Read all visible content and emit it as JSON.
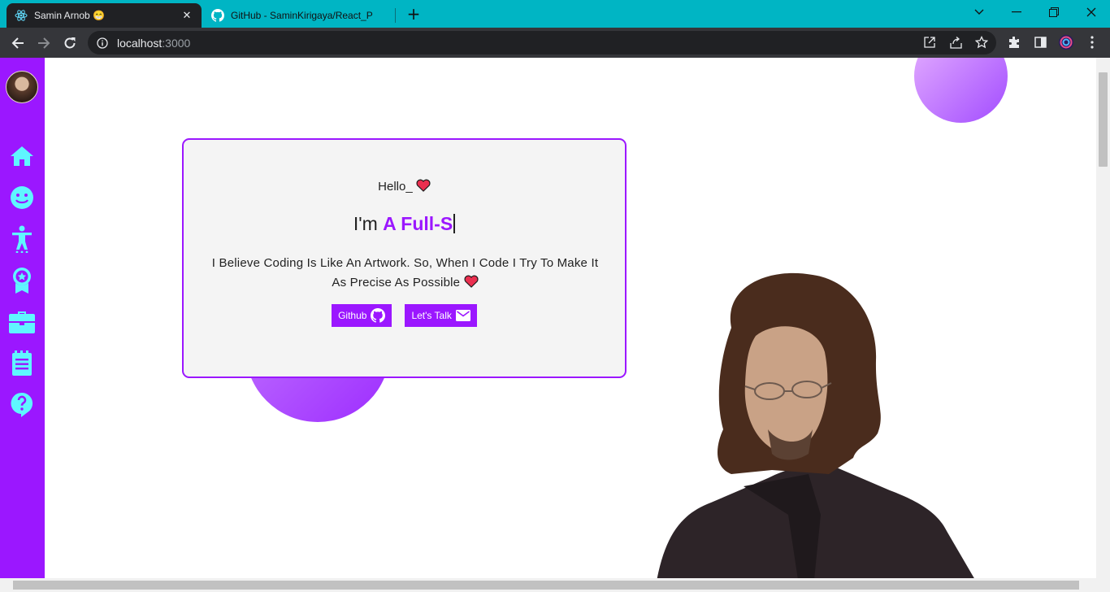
{
  "browser": {
    "tabs": [
      {
        "title": "Samin Arnob 😁",
        "active": true
      },
      {
        "title": "GitHub - SaminKirigaya/React_P",
        "active": false
      }
    ],
    "newtab_label": "+",
    "url_host": "localhost",
    "url_port": ":3000",
    "toolbar_icons": [
      "back-icon",
      "forward-icon",
      "reload-icon",
      "info-icon",
      "open-in-app-icon",
      "share-icon",
      "bookmark-star-icon",
      "extensions-icon",
      "side-panel-icon",
      "profile-icon",
      "menu-dots-icon"
    ]
  },
  "sidebar": {
    "items": [
      {
        "name": "home",
        "icon": "home-icon"
      },
      {
        "name": "about",
        "icon": "smiley-icon"
      },
      {
        "name": "skills",
        "icon": "accessibility-icon"
      },
      {
        "name": "achievements",
        "icon": "award-icon"
      },
      {
        "name": "experience",
        "icon": "briefcase-icon"
      },
      {
        "name": "blog",
        "icon": "notes-icon"
      },
      {
        "name": "help",
        "icon": "help-icon"
      }
    ],
    "color": "#9b17ff",
    "icon_color": "#5ff6ff"
  },
  "hero": {
    "greeting": "Hello_",
    "role_prefix": "I'm ",
    "role_typed": "A Full-S",
    "description": "I Believe Coding Is Like An Artwork. So, When I Code I Try To Make It As Precise As Possible",
    "buttons": {
      "github_label": "Github",
      "talk_label": "Let's Talk"
    },
    "accent": "#9b17ff"
  }
}
